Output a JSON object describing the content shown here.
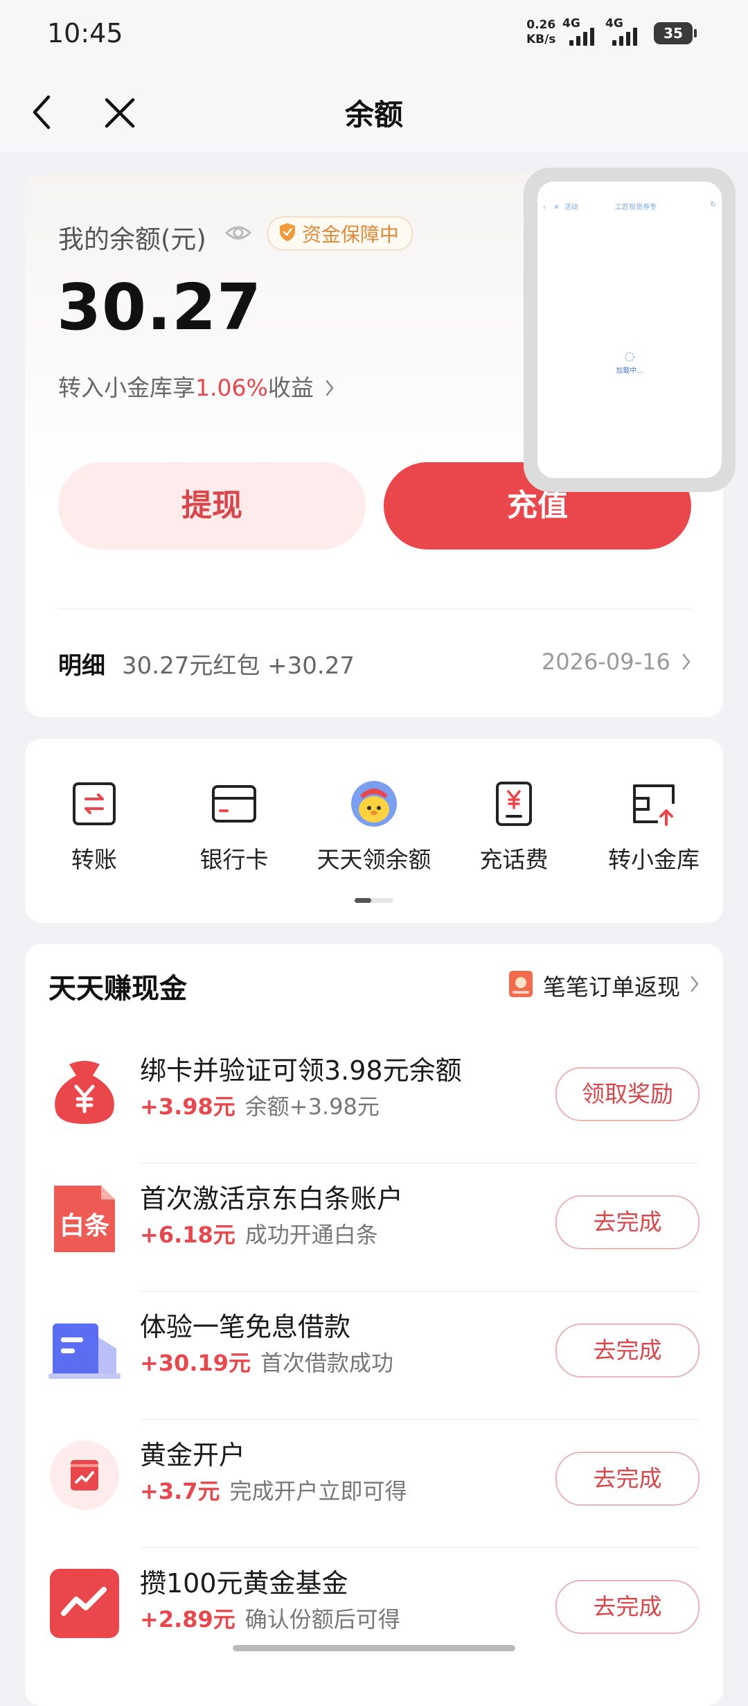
{
  "status_bar": {
    "time": "10:45",
    "net_speed_value": "0.26",
    "net_speed_unit": "KB/s",
    "signal_1": "4G",
    "signal_2": "4G",
    "battery": "35"
  },
  "nav": {
    "title": "余额",
    "back_icon": "chevron-left-icon",
    "close_icon": "close-icon"
  },
  "balance": {
    "label": "我的余额(元)",
    "guarantee_badge": "资金保障中",
    "amount": "30.27",
    "promo_prefix": "转入小金库享",
    "promo_rate": "1.06%",
    "promo_suffix": "收益",
    "withdraw_label": "提现",
    "recharge_label": "充值",
    "detail_label": "明细",
    "detail_text": "30.27元红包 +30.27",
    "detail_date": "2026-09-16"
  },
  "quick_actions": [
    {
      "label": "转账",
      "icon": "transfer-icon"
    },
    {
      "label": "银行卡",
      "icon": "bank-card-icon"
    },
    {
      "label": "天天领余额",
      "icon": "mascot-icon"
    },
    {
      "label": "充话费",
      "icon": "phone-bill-icon"
    },
    {
      "label": "转小金库",
      "icon": "vault-transfer-icon"
    }
  ],
  "earn": {
    "title": "天天赚现金",
    "link_text": "笔笔订单返现",
    "tasks": [
      {
        "title": "绑卡并验证可领3.98元余额",
        "reward": "+3.98元",
        "desc": "余额+3.98元",
        "button": "领取奖励",
        "icon": "money-bag-icon"
      },
      {
        "title": "首次激活京东白条账户",
        "reward": "+6.18元",
        "desc": "成功开通白条",
        "button": "去完成",
        "icon": "baitiao-icon"
      },
      {
        "title": "体验一笔免息借款",
        "reward": "+30.19元",
        "desc": "首次借款成功",
        "button": "去完成",
        "icon": "loan-icon"
      },
      {
        "title": "黄金开户",
        "reward": "+3.7元",
        "desc": "完成开户立即可得",
        "button": "去完成",
        "icon": "gold-account-icon"
      },
      {
        "title": "攒100元黄金基金",
        "reward": "+2.89元",
        "desc": "确认份额后可得",
        "button": "去完成",
        "icon": "gold-fund-icon"
      }
    ]
  },
  "mini_window": {
    "tab_text": "活动",
    "page_title": "工匠现货券专",
    "loading_text": "加载中..."
  },
  "colors": {
    "accent": "#e9474b",
    "accent_soft": "#fdeceb",
    "background": "#f1f1f6"
  }
}
